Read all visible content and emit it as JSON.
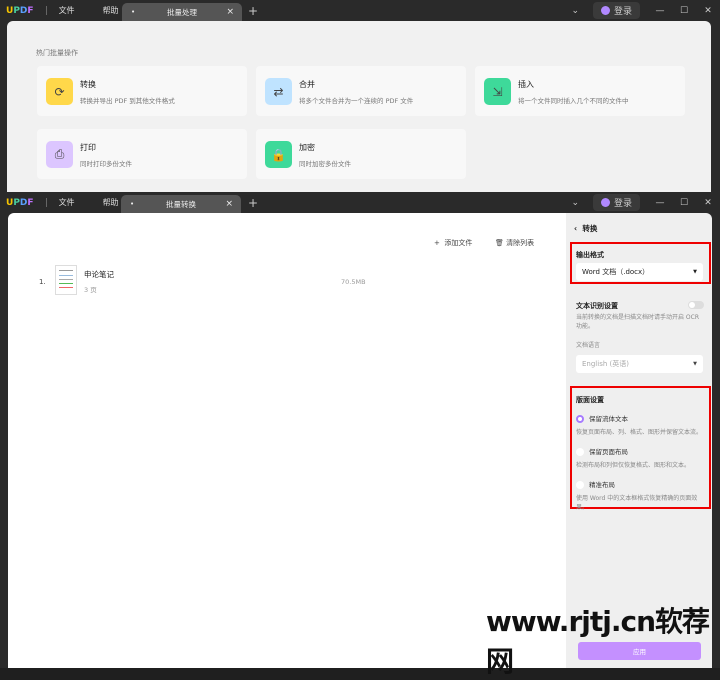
{
  "app": {
    "logo": "UPDF",
    "menu": [
      "文件",
      "帮助"
    ],
    "login": "登录"
  },
  "top": {
    "tab": "批量处理",
    "section_title": "热门批量操作",
    "cards": [
      {
        "title": "转换",
        "desc": "转换并导出 PDF 到其他文件格式",
        "color": "#ffd84a",
        "icon": "convert-icon"
      },
      {
        "title": "合并",
        "desc": "将多个文件合并为一个连续的 PDF 文件",
        "color": "#bfe3ff",
        "icon": "merge-icon"
      },
      {
        "title": "插入",
        "desc": "将一个文件同时插入几个不同的文件中",
        "color": "#3ed99a",
        "icon": "insert-icon"
      },
      {
        "title": "打印",
        "desc": "同时打印多份文件",
        "color": "#dcc6ff",
        "icon": "print-icon"
      },
      {
        "title": "加密",
        "desc": "同时加密多份文件",
        "color": "#3ed99a",
        "icon": "lock-icon"
      }
    ]
  },
  "bottom": {
    "tab": "批量转换",
    "add_file": "添加文件",
    "clear_list": "清除列表",
    "files": [
      {
        "index": "1.",
        "name": "申论笔记",
        "pages": "3 页",
        "size": "70.5MB"
      }
    ],
    "side": {
      "back": "转换",
      "output_label": "输出格式",
      "output_value": "Word 文档（.docx）",
      "ocr_label": "文本识别设置",
      "ocr_desc": "当前转换的文档是扫描文档时请手动开启 OCR 功能。",
      "ocr_enabled": false,
      "lang_label": "文档语言",
      "lang_value": "English (英语)",
      "layout_label": "版面设置",
      "options": [
        {
          "label": "保留流体文本",
          "desc": "恢复页面布局、列、格式、图形并保留文本流。",
          "selected": true
        },
        {
          "label": "保留页面布局",
          "desc": "检测布局和列但仅恢复格式、图形和文本。",
          "selected": false
        },
        {
          "label": "精准布局",
          "desc": "使用 Word 中的文本框格式恢复精确的页面效果。",
          "selected": false
        }
      ],
      "apply": "应用"
    }
  },
  "watermark": "www.rjtj.cn软荐网",
  "colors": {
    "accent": "#a77bff",
    "highlight": "#e00000"
  }
}
